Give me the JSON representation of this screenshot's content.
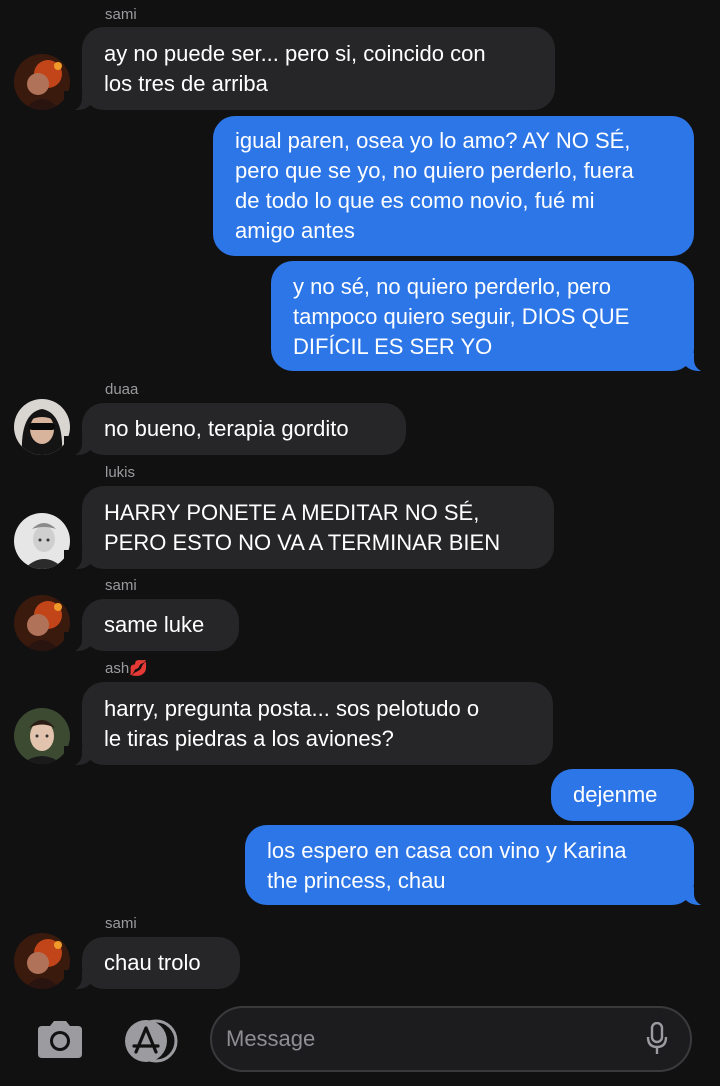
{
  "messages": [
    {
      "sender": "sami",
      "text": "ay no puede ser... pero si, coincido con\nlos tres de arriba"
    },
    {
      "text": "igual paren, osea yo lo amo? AY NO SÉ,\npero que se yo, no quiero perderlo, fuera\nde todo lo que es como novio, fué mi\namigo antes"
    },
    {
      "text": "y no sé, no quiero perderlo, pero\ntampoco quiero seguir, DIOS QUE\nDIFÍCIL ES SER YO"
    },
    {
      "sender": "duaa",
      "text": "no bueno, terapia gordito"
    },
    {
      "sender": "lukis",
      "text": "HARRY PONETE A MEDITAR NO SÉ,\nPERO ESTO NO VA A TERMINAR BIEN"
    },
    {
      "sender": "sami",
      "text": "same luke"
    },
    {
      "sender": "ash💋",
      "text": "harry, pregunta posta... sos pelotudo o\nle tiras piedras a los aviones?"
    },
    {
      "text": "dejenme"
    },
    {
      "text": "los espero en casa con vino y Karina\nthe princess, chau"
    },
    {
      "sender": "sami",
      "text": "chau trolo"
    }
  ],
  "composer": {
    "placeholder": "Message",
    "camera_icon": "camera-icon",
    "apps_icon": "app-store-icon",
    "mic_icon": "microphone-icon"
  },
  "colors": {
    "background": "#111111",
    "incoming_bubble": "#262628",
    "outgoing_bubble": "#2d76e8",
    "sender_name": "#9a9a9f"
  }
}
